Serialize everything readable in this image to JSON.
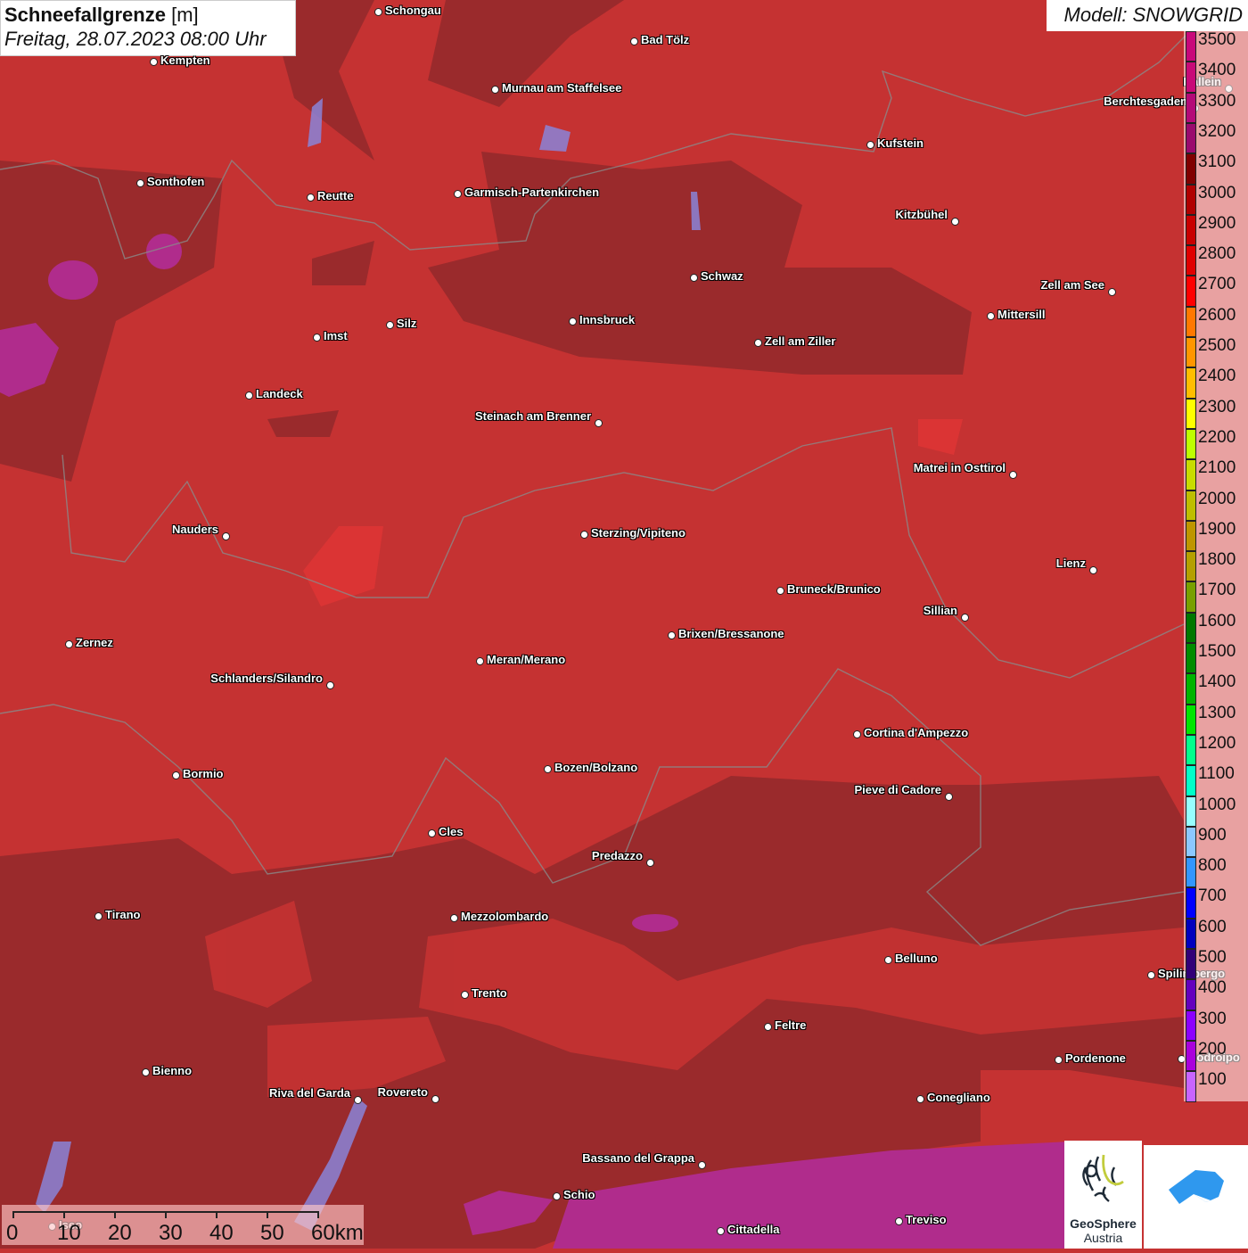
{
  "title": {
    "main": "Schneefallgrenze",
    "unit": "[m]",
    "datetime": "Freitag, 28.07.2023 08:00 Uhr"
  },
  "model": "Modell: SNOWGRID",
  "legend": {
    "values": [
      "3500",
      "3400",
      "3300",
      "3200",
      "3100",
      "3000",
      "2900",
      "2800",
      "2700",
      "2600",
      "2500",
      "2400",
      "2300",
      "2200",
      "2100",
      "2000",
      "1900",
      "1800",
      "1700",
      "1600",
      "1500",
      "1400",
      "1300",
      "1200",
      "1100",
      "1000",
      "900",
      "800",
      "700",
      "600",
      "500",
      "400",
      "300",
      "200",
      "100"
    ],
    "colors": [
      "#c8087a",
      "#c80a78",
      "#b40a78",
      "#9a0a6e",
      "#800000",
      "#b00000",
      "#c80000",
      "#e00000",
      "#ff0000",
      "#ff7800",
      "#ff9600",
      "#ffbe00",
      "#ffff00",
      "#beff00",
      "#c8dc00",
      "#bebe00",
      "#be9600",
      "#b4a000",
      "#78a000",
      "#007800",
      "#008c00",
      "#00b400",
      "#00e600",
      "#00ff8c",
      "#00ffc8",
      "#96ffff",
      "#8cc8ff",
      "#3296ff",
      "#0000ff",
      "#0000be",
      "#320078",
      "#6400be",
      "#8c00ff",
      "#aa00dc",
      "#c864ff"
    ]
  },
  "cities": [
    "Schongau",
    "Bad Tölz",
    "Kempten",
    "Murnau am Staffelsee",
    "Hallein",
    "Berchtesgaden",
    "Kufstein",
    "Sonthofen",
    "Reutte",
    "Garmisch-Partenkirchen",
    "Kitzbühel",
    "Schwaz",
    "Zell am See",
    "Innsbruck",
    "Silz",
    "Mittersill",
    "Imst",
    "Zell am Ziller",
    "Landeck",
    "Steinach am Brenner",
    "Matrei in Osttirol",
    "Nauders",
    "Sterzing/Vipiteno",
    "Lienz",
    "Bruneck/Brunico",
    "Sillian",
    "Brixen/Bressanone",
    "Zernez",
    "Meran/Merano",
    "Schlanders/Silandro",
    "Cortina d'Ampezzo",
    "Bozen/Bolzano",
    "Bormio",
    "Pieve di Cadore",
    "Cles",
    "Predazzo",
    "Tirano",
    "Mezzolombardo",
    "Belluno",
    "Spilimbergo",
    "Trento",
    "Feltre",
    "Pordenone",
    "Codroipo",
    "Bienno",
    "Riva del Garda",
    "Rovereto",
    "Conegliano",
    "Bassano del Grappa",
    "Schio",
    "Treviso",
    "Cittadella",
    "Iseo"
  ],
  "scale": {
    "labels": [
      "0",
      "10",
      "20",
      "30",
      "40",
      "50",
      "60km"
    ]
  },
  "logos": {
    "geosphere_line1": "GeoSphere",
    "geosphere_line2": "Austria"
  },
  "map_colors": {
    "base": "#c53232",
    "dark": "#9a2a2c",
    "bright": "#e03434",
    "low": "#b02c8c"
  }
}
